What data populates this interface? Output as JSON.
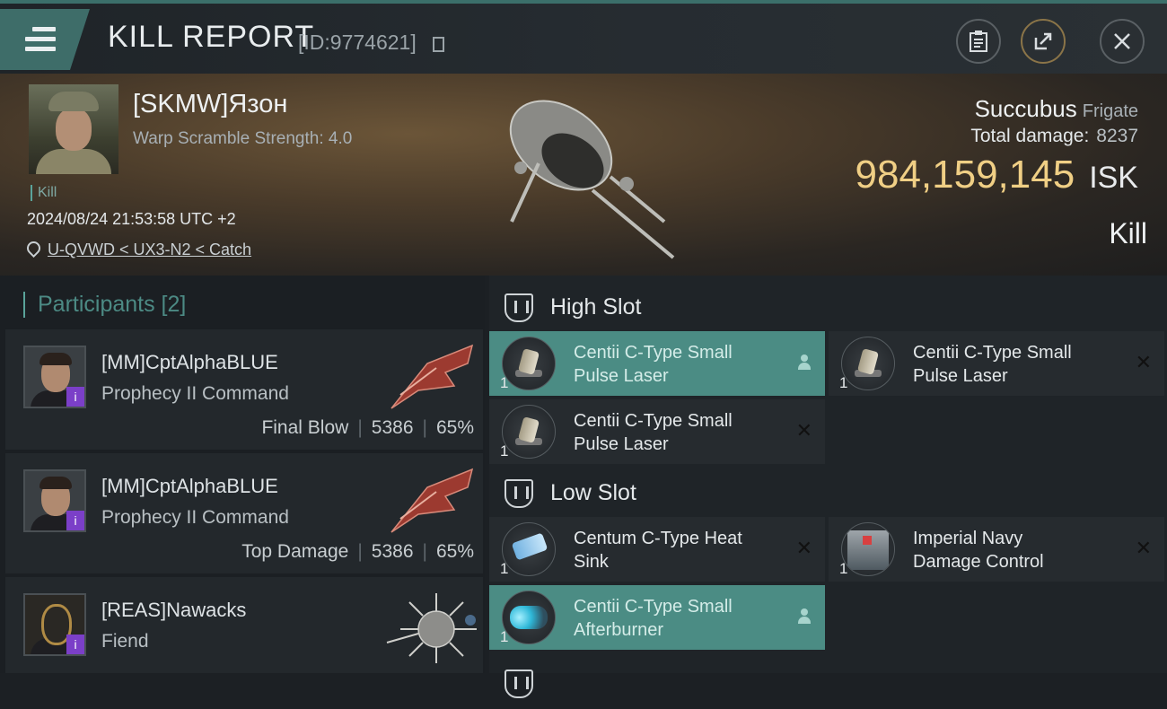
{
  "header": {
    "title": "KILL REPORT",
    "id_label": "[ID:9774621]",
    "menu_icon": "hamburger-icon",
    "buttons": [
      {
        "name": "clipboard-button",
        "icon": "clipboard-icon",
        "glyph": "📋"
      },
      {
        "name": "share-button",
        "icon": "external-share-icon",
        "glyph": "⇗"
      },
      {
        "name": "close-button",
        "icon": "close-icon",
        "glyph": "✕"
      }
    ]
  },
  "victim": {
    "name": "[SKMW]Язон",
    "warp_scramble": "Warp Scramble Strength: 4.0",
    "tag": "Kill",
    "datetime": "2024/08/24 21:53:58 UTC +2",
    "location": "U-QVWD < UX3-N2 < Catch",
    "ship_name": "Succubus",
    "ship_class": "Frigate",
    "total_damage_label": "Total damage:",
    "total_damage": "8237",
    "isk_value": "984,159,145",
    "isk_unit": "ISK",
    "result": "Kill"
  },
  "participants": {
    "header": "Participants [2]",
    "rows": [
      {
        "name": "[MM]CptAlphaBLUE",
        "ship": "Prophecy II Command",
        "stat_label": "Final Blow",
        "damage": "5386",
        "percent": "65%",
        "badge": "i"
      },
      {
        "name": "[MM]CptAlphaBLUE",
        "ship": "Prophecy II Command",
        "stat_label": "Top Damage",
        "damage": "5386",
        "percent": "65%",
        "badge": "i"
      },
      {
        "name": "[REAS]Nawacks",
        "ship": "Fiend",
        "stat_label": "",
        "damage": "",
        "percent": "",
        "badge": "i"
      }
    ]
  },
  "fitting": {
    "high_slot": {
      "title": "High Slot",
      "modules": [
        {
          "name_line1": "Centii C-Type Small",
          "name_line2": "Pulse Laser",
          "qty": "1",
          "status": "person"
        },
        {
          "name_line1": "Centii C-Type Small",
          "name_line2": "Pulse Laser",
          "qty": "1",
          "status": "destroyed"
        },
        {
          "name_line1": "Centii C-Type Small",
          "name_line2": "Pulse Laser",
          "qty": "1",
          "status": "destroyed"
        }
      ]
    },
    "low_slot": {
      "title": "Low Slot",
      "modules": [
        {
          "name_line1": "Centum C-Type Heat",
          "name_line2": "Sink",
          "qty": "1",
          "status": "destroyed"
        },
        {
          "name_line1": "Imperial Navy",
          "name_line2": "Damage Control",
          "qty": "1",
          "status": "destroyed"
        },
        {
          "name_line1": "Centii C-Type Small",
          "name_line2": "Afterburner",
          "qty": "1",
          "status": "person"
        }
      ]
    },
    "destroyed_mark": "✕",
    "accent_color": "#4b8c84"
  }
}
